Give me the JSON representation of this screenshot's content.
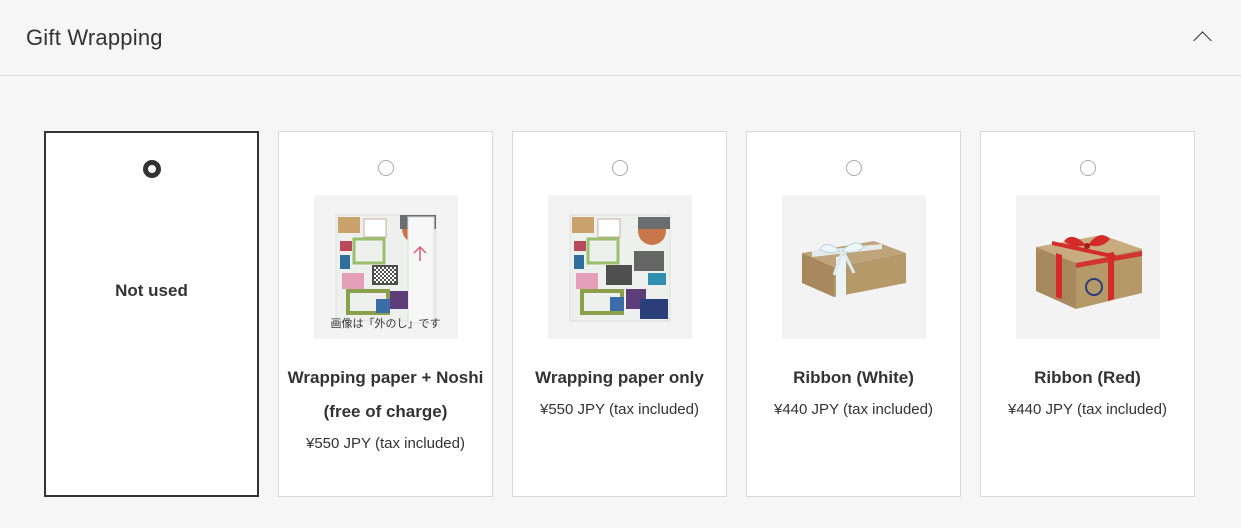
{
  "section": {
    "title": "Gift Wrapping"
  },
  "options": [
    {
      "label": "Not used",
      "selected": true
    },
    {
      "title_line1": "Wrapping paper + Noshi",
      "title_line2": "(free of charge)",
      "price": "¥550 JPY (tax included)",
      "image_caption": "画像は「外のし」です",
      "selected": false
    },
    {
      "title_line1": "Wrapping paper only",
      "price": "¥550 JPY (tax included)",
      "selected": false
    },
    {
      "title_line1": "Ribbon (White)",
      "price": "¥440 JPY (tax included)",
      "selected": false
    },
    {
      "title_line1": "Ribbon (Red)",
      "price": "¥440 JPY (tax included)",
      "selected": false
    }
  ],
  "icons": {
    "collapse": "chevron-up-icon",
    "radio_selected": "radio-selected-icon",
    "radio_unselected": "radio-unselected-icon"
  },
  "colors": {
    "selected_border": "#333333",
    "card_border": "#d9d9d9",
    "background": "#f6f6f6",
    "ribbon_red": "#d42a2a"
  }
}
